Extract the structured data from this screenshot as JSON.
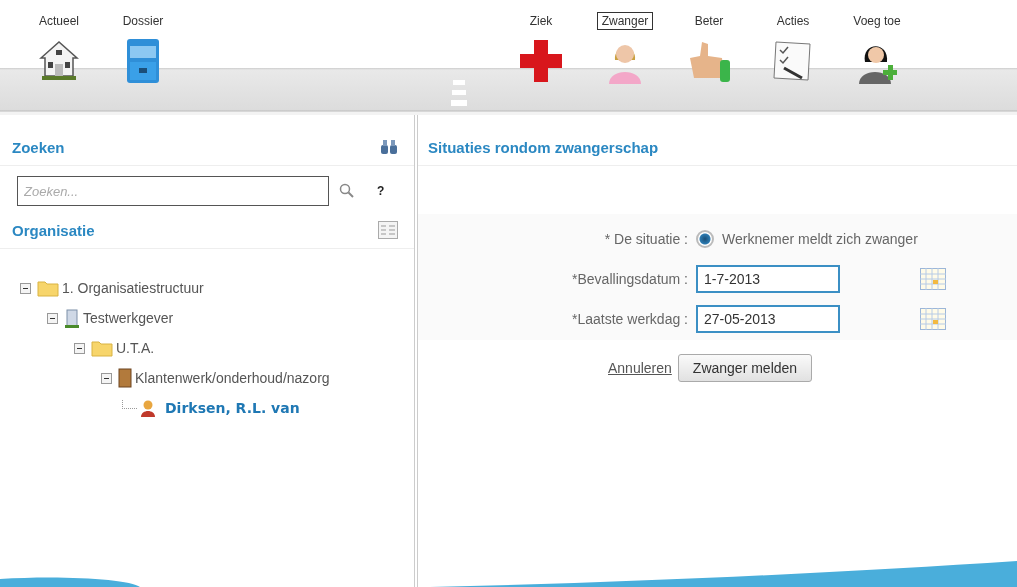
{
  "toolbar": {
    "left": [
      {
        "kind": "home",
        "label": "Actueel",
        "selected": false
      },
      {
        "kind": "dossier",
        "label": "Dossier",
        "selected": false
      }
    ],
    "right": [
      {
        "kind": "sick",
        "label": "Ziek",
        "selected": false
      },
      {
        "kind": "pregnant",
        "label": "Zwanger",
        "selected": true
      },
      {
        "kind": "better",
        "label": "Beter",
        "selected": false
      },
      {
        "kind": "actions",
        "label": "Acties",
        "selected": false
      },
      {
        "kind": "add",
        "label": "Voeg toe",
        "selected": false
      }
    ]
  },
  "sidebar": {
    "search_title": "Zoeken",
    "search": {
      "placeholder": "Zoeken...",
      "help": "?"
    },
    "tree_title": "Organisatie",
    "tree": [
      {
        "kind": "folder",
        "label": "1. Organisatiestructuur",
        "selected": false,
        "children": [
          {
            "kind": "building",
            "label": "Testwerkgever",
            "selected": false,
            "children": [
              {
                "kind": "folder",
                "label": "U.T.A.",
                "selected": false,
                "children": [
                  {
                    "kind": "door",
                    "label": "Klantenwerk/onderhoud/nazorg",
                    "selected": false,
                    "children": [
                      {
                        "kind": "person",
                        "label": "Dirksen, R.L. van",
                        "selected": true
                      }
                    ]
                  }
                ]
              }
            ]
          }
        ]
      }
    ]
  },
  "panel": {
    "title": "Situaties rondom zwangerschap",
    "fields": [
      {
        "kind": "radio",
        "label": "* De situatie :",
        "option": "Werknemer meldt zich zwanger",
        "checked": true
      },
      {
        "kind": "date",
        "label": "*Bevallingsdatum :",
        "value": "1-7-2013"
      },
      {
        "kind": "date",
        "label": "*Laatste werkdag :",
        "value": "27-05-2013"
      }
    ],
    "cancel": "Annuleren",
    "submit": "Zwanger melden"
  }
}
